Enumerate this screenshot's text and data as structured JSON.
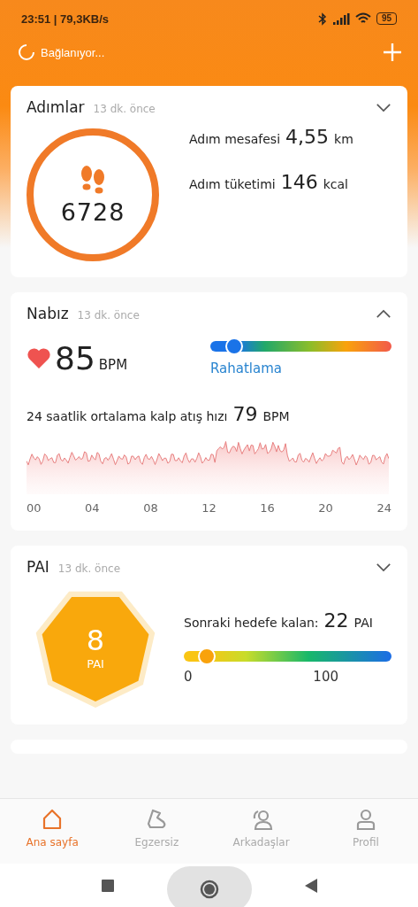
{
  "status_bar": {
    "time": "23:51 | 79,3KB/s",
    "battery": "95"
  },
  "header": {
    "status": "Bağlanıyor..."
  },
  "steps_card": {
    "title": "Adımlar",
    "updated": "13 dk. önce",
    "expanded": false,
    "steps": "6728",
    "stats": [
      {
        "label": "Adım mesafesi",
        "value": "4,55",
        "unit": "km"
      },
      {
        "label": "Adım tüketimi",
        "value": "146",
        "unit": "kcal"
      }
    ]
  },
  "heart_card": {
    "title": "Nabız",
    "updated": "13 dk. önce",
    "expanded": true,
    "bpm": "85",
    "bpm_unit": "BPM",
    "zone": {
      "level": 0.13,
      "label": "Rahatlama"
    },
    "average_label": "24 saatlik ortalama kalp atış hızı",
    "average_value": "79",
    "average_unit": "BPM",
    "x_labels": [
      "00",
      "04",
      "08",
      "12",
      "16",
      "20",
      "24"
    ]
  },
  "pai_card": {
    "title": "PAI",
    "updated": "13 dk. önce",
    "expanded": false,
    "value": "8",
    "unit": "PAI",
    "remaining_label": "Sonraki hedefe kalan:",
    "remaining_value": "22",
    "remaining_unit": "PAI",
    "progress": {
      "level": 0.11,
      "min": "0",
      "max": "100"
    }
  },
  "tabs": [
    {
      "label": "Ana sayfa",
      "kind": "home",
      "selected": true
    },
    {
      "label": "Egzersiz",
      "kind": "shoe",
      "selected": false
    },
    {
      "label": "Arkadaşlar",
      "kind": "friends",
      "selected": false
    },
    {
      "label": "Profil",
      "kind": "profile",
      "selected": false
    }
  ]
}
